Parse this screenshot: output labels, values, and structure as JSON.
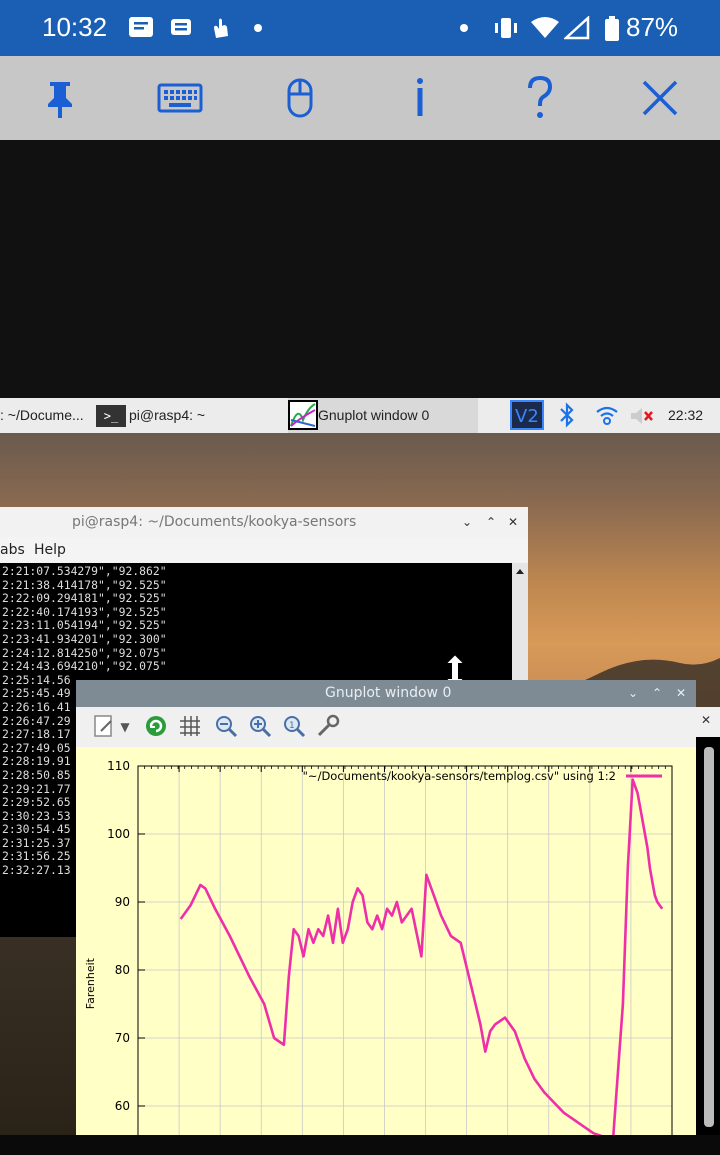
{
  "status_bar": {
    "time": "10:32",
    "battery": "87%",
    "icons": [
      "message-icon",
      "news-icon",
      "gesture-icon",
      "dot-icon",
      "vibrate-icon",
      "wifi-icon",
      "signal-icon",
      "battery-icon"
    ]
  },
  "vnc_toolbar": {
    "buttons": [
      "pin-icon",
      "keyboard-icon",
      "mouse-icon",
      "info-icon",
      "help-icon",
      "close-icon"
    ]
  },
  "taskbar": {
    "task_documents": ": ~/Docume...",
    "task_terminal": "pi@rasp4: ~",
    "task_gnuplot": "Gnuplot window 0",
    "clock": "22:32"
  },
  "terminal": {
    "title": "pi@rasp4: ~/Documents/kookya-sensors",
    "menu": [
      "abs",
      "Help"
    ],
    "lines": [
      "2:21:07.534279\",\"92.862\"",
      "2:21:38.414178\",\"92.525\"",
      "2:22:09.294181\",\"92.525\"",
      "2:22:40.174193\",\"92.525\"",
      "2:23:11.054194\",\"92.525\"",
      "2:23:41.934201\",\"92.300\"",
      "2:24:12.814250\",\"92.075\"",
      "2:24:43.694210\",\"92.075\"",
      "2:25:14.56",
      "2:25:45.49",
      "2:26:16.41",
      "2:26:47.29",
      "2:27:18.17",
      "2:27:49.05",
      "2:28:19.91",
      "2:28:50.85",
      "2:29:21.77",
      "2:29:52.65",
      "2:30:23.53",
      "2:30:54.45",
      "2:31:25.37",
      "2:31:56.25",
      "2:32:27.13"
    ]
  },
  "gnuplot": {
    "title": "Gnuplot window 0",
    "tools": [
      "copy-icon",
      "dropdown-icon",
      "replot-icon",
      "grid-icon",
      "zoom-out-icon",
      "zoom-in-icon",
      "zoom-reset-icon",
      "settings-icon"
    ]
  },
  "chart_data": {
    "type": "line",
    "ylabel": "Farenheit",
    "xlabel": "",
    "ylim": [
      55,
      110
    ],
    "yticks": [
      60,
      70,
      80,
      90,
      100,
      110
    ],
    "grid": true,
    "legend_position": "top-right",
    "series": [
      {
        "name": "\"~/Documents/kookya-sensors/templog.csv\" using 1:2",
        "color": "#ee2fa8",
        "x": [
          0,
          2,
          4,
          5,
          7,
          10,
          14,
          17,
          19,
          21,
          22,
          23,
          24,
          25,
          26,
          27,
          28,
          29,
          30,
          31,
          32,
          33,
          34,
          35,
          36,
          37,
          38,
          39,
          40,
          41,
          42,
          43,
          44,
          45,
          47,
          49,
          50,
          51,
          53,
          55,
          57,
          59,
          61,
          62,
          63,
          64,
          65,
          66,
          68,
          70,
          72,
          74,
          76,
          78,
          80,
          82,
          84,
          86,
          88,
          90,
          91,
          92,
          93,
          94,
          95,
          95.5,
          96,
          96.5,
          97,
          98
        ],
        "y": [
          87.5,
          89.5,
          92.5,
          92,
          89,
          85,
          79,
          75,
          70,
          69,
          79,
          86,
          85,
          82,
          86,
          84,
          86,
          85,
          88,
          84,
          89,
          84,
          86,
          90,
          92,
          91,
          87,
          86,
          88,
          86,
          89,
          88,
          90,
          87,
          89,
          82,
          94,
          92,
          88,
          85,
          84,
          78,
          72,
          68,
          71,
          72,
          72.5,
          73,
          71,
          67,
          64,
          62,
          60.5,
          59,
          58,
          57,
          56,
          55.5,
          55,
          75,
          95,
          108,
          106,
          102,
          98,
          95,
          93,
          91,
          90,
          89
        ]
      }
    ]
  }
}
